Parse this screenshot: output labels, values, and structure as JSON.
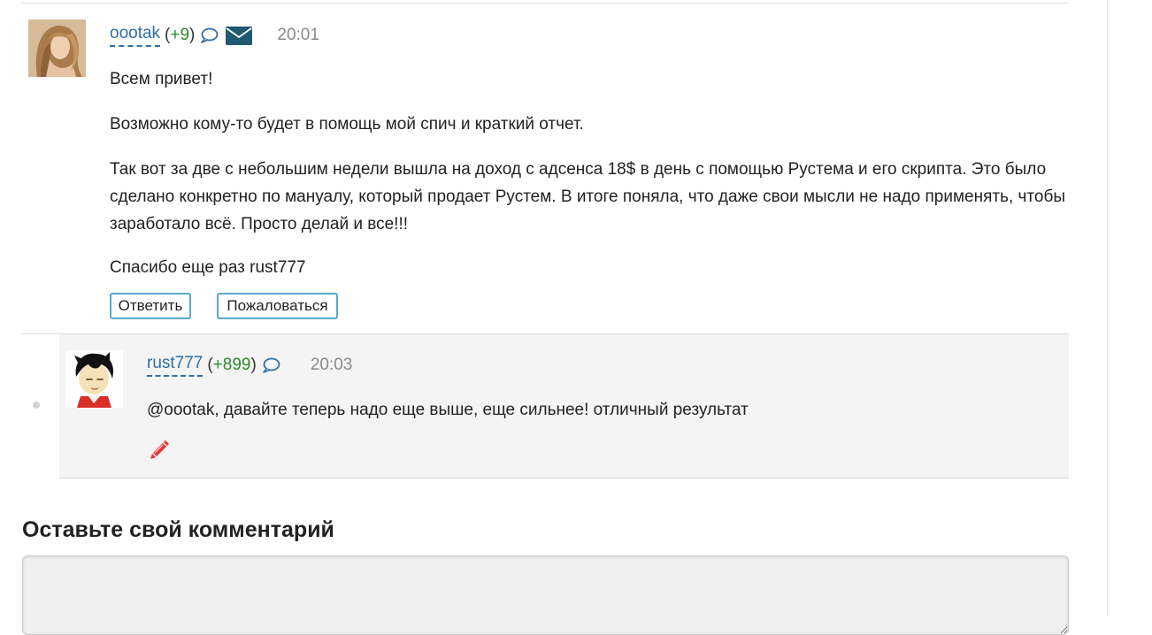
{
  "comments": [
    {
      "author": "oootak",
      "karma_open": "(",
      "karma": "+9",
      "karma_close": ")",
      "time": "20:01",
      "paragraphs": [
        "Всем привет!",
        "Возможно кому-то будет в помощь мой спич и краткий отчет.",
        "Так вот за две с небольшим недели вышла на доход с адсенса 18$ в день с помощью Рустема и его скрипта. Это было сделано конкретно по мануалу, который продает Рустем. В итоге поняла, что даже свои мысли не надо применять, чтобы заработало всё. Просто делай и все!!!",
        "Спасибо еще раз rust777"
      ],
      "buttons": {
        "reply": "Ответить",
        "report": "Пожаловаться"
      },
      "icons": [
        "speech-bubble-icon",
        "envelope-icon"
      ]
    },
    {
      "author": "rust777",
      "karma_open": "(",
      "karma": "+899",
      "karma_close": ")",
      "time": "20:03",
      "text": "@oootak, давайте теперь надо еще выше, еще сильнее! отличный результат",
      "icons": [
        "speech-bubble-icon",
        "pencil-icon"
      ]
    }
  ],
  "form": {
    "heading": "Оставьте свой комментарий",
    "textarea_value": ""
  },
  "colors": {
    "link": "#2f6fa8",
    "karma_positive": "#2d8a2d",
    "button_border": "#5aa8c8",
    "reply_background": "#f4f4f4",
    "edit_icon": "#e8312f"
  }
}
